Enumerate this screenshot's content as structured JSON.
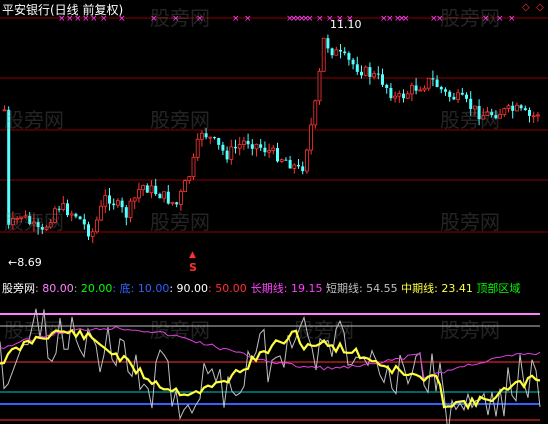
{
  "header": {
    "title": "平安银行(日线 前复权)"
  },
  "price_panel": {
    "high_label": "11.10",
    "low_label": "8.69",
    "signal_marker": "S",
    "signal_arrow": "▲",
    "top_right_icons": [
      "◇",
      "◇"
    ],
    "candle_up_color": "#ff3232",
    "candle_down_color": "#54ffff",
    "gridline_color": "#8b0000",
    "magenta_marks_color": "#ff40ff",
    "marker_glyph": "×"
  },
  "indicator_legend": {
    "name": "股旁网",
    "v1": ": 80.00",
    "v2": ": 20.00",
    "di_label": ": 底:",
    "di_value": " 10.00",
    "v3": ": 90.00",
    "v4": ": 50.00",
    "long_label": "长期线:",
    "long_value": " 19.15",
    "short_label": " 短期线:",
    "short_value": " 54.55",
    "mid_label": " 中期线:",
    "mid_value": " 23.41",
    "top_zone": " 顶部区域",
    "colors": {
      "line80": "#ff80ff",
      "line20": "#00ff00",
      "di": "#3060ff",
      "line90": "#ffffff",
      "line50": "#ff3030",
      "long": "#ff40ff",
      "short": "#c0c0c0",
      "mid": "#ffff40",
      "top_zone": "#00ff00"
    }
  },
  "watermarks": [
    "股旁网",
    "股旁网",
    "股旁网",
    "股旁网",
    "股旁网",
    "股旁网",
    "股旁网",
    "股旁网",
    "股旁网",
    "股旁网",
    "股旁网",
    "股旁网"
  ]
}
